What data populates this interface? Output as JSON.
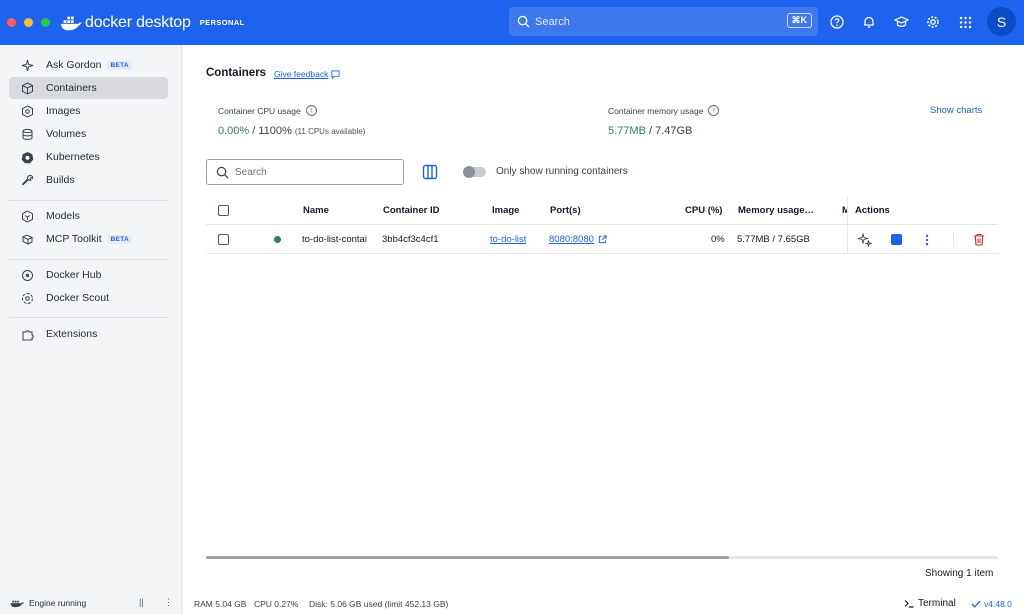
{
  "app": {
    "brand": "docker desktop",
    "plan_badge": "PERSONAL",
    "avatar_letter": "S"
  },
  "topbar": {
    "search_placeholder": "Search",
    "shortcut": "⌘K",
    "icons": [
      "help-icon",
      "bell-icon",
      "learning-icon",
      "gear-icon",
      "apps-grid-icon"
    ]
  },
  "sidebar": {
    "items": [
      {
        "label": "Ask Gordon",
        "badge": "BETA",
        "icon": "sparkle-icon"
      },
      {
        "label": "Containers",
        "icon": "cube-icon",
        "active": true
      },
      {
        "label": "Images",
        "icon": "images-icon"
      },
      {
        "label": "Volumes",
        "icon": "volumes-icon"
      },
      {
        "label": "Kubernetes",
        "icon": "kubernetes-icon"
      },
      {
        "label": "Builds",
        "icon": "wrench-icon"
      },
      {
        "label": "Models",
        "icon": "models-icon"
      },
      {
        "label": "MCP Toolkit",
        "badge": "BETA",
        "icon": "toolkit-icon"
      },
      {
        "label": "Docker Hub",
        "icon": "hub-icon"
      },
      {
        "label": "Docker Scout",
        "icon": "scout-icon"
      },
      {
        "label": "Extensions",
        "icon": "puzzle-icon"
      }
    ],
    "engine_status": "Engine running",
    "pause_glyph": "||",
    "menu_glyph": "⋮"
  },
  "page": {
    "title": "Containers",
    "feedback": "Give feedback",
    "show_charts": "Show charts"
  },
  "metrics": {
    "cpu_label": "Container CPU usage",
    "cpu_value": "0.00%",
    "cpu_total": " / 1100%",
    "cpu_note": "(11 CPUs available)",
    "mem_label": "Container memory usage",
    "mem_value": "5.77MB",
    "mem_total": " / 7.47GB"
  },
  "filters": {
    "search_placeholder": "Search",
    "toggle_label": "Only show running containers",
    "toggle_on": false
  },
  "table": {
    "headers": {
      "name": "Name",
      "container_id": "Container ID",
      "image": "Image",
      "ports": "Port(s)",
      "cpu": "CPU (%)",
      "memory": "Memory usage…",
      "more": "M",
      "actions": "Actions"
    },
    "rows": [
      {
        "status": "running",
        "name": "to-do-list-contai",
        "container_id": "3bb4cf3c4cf1",
        "image": "to-do-list",
        "ports": "8080:8080",
        "cpu": "0%",
        "memory": "5.77MB / 7.65GB"
      }
    ],
    "scroll_fraction": 0.66
  },
  "showing": "Showing 1 item",
  "footer": {
    "ram": "RAM 5.04 GB",
    "cpu": "CPU 0.27%",
    "disk": "Disk: 5.06 GB used (limit 452.13 GB)",
    "terminal": "Terminal",
    "version": "v4.48.0"
  },
  "colors": {
    "brand_blue": "#1d63ed",
    "running_green": "#2e7d6a",
    "delete_red": "#dc2626"
  }
}
